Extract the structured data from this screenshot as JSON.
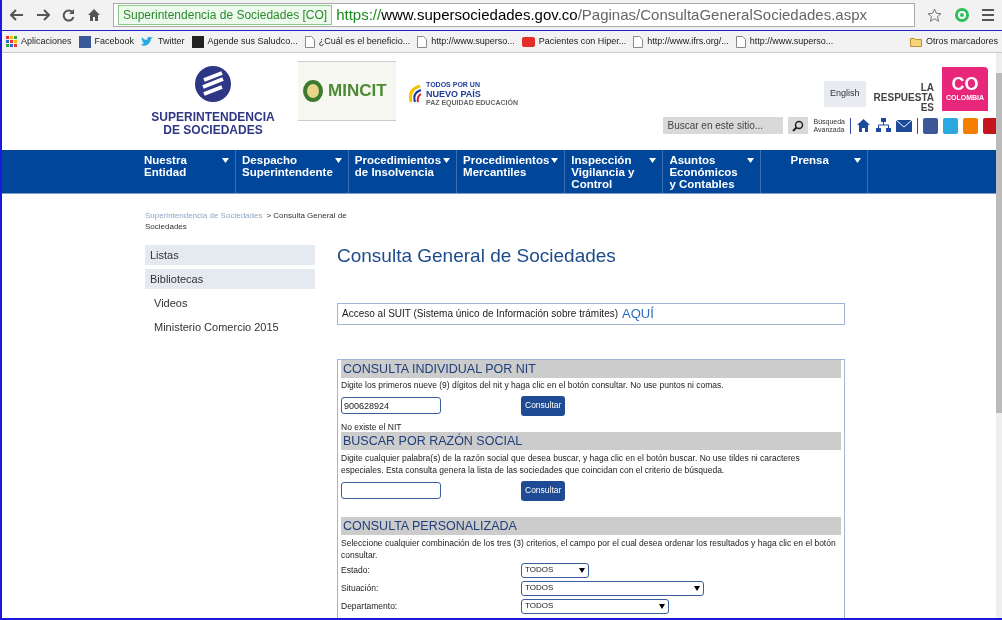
{
  "browser": {
    "site_badge": "Superintendencia de Sociedades [CO]",
    "url_scheme": "https://",
    "url_host": "www.supersociedades.gov.co",
    "url_path": "/Paginas/ConsultaGeneralSociedades.aspx"
  },
  "bookmarks": [
    {
      "kind": "apps",
      "label": "Aplicaciones"
    },
    {
      "kind": "facebook",
      "label": "Facebook"
    },
    {
      "kind": "twitter",
      "label": "Twitter"
    },
    {
      "kind": "info",
      "label": "Agende sus Saludco..."
    },
    {
      "kind": "page",
      "label": "¿Cuál es el beneficio..."
    },
    {
      "kind": "page",
      "label": "http://www.superso..."
    },
    {
      "kind": "youtube",
      "label": "Pacientes con Hiper..."
    },
    {
      "kind": "page",
      "label": "http://www.ifrs.org/..."
    },
    {
      "kind": "page",
      "label": "http://www.superso..."
    }
  ],
  "other_bookmarks": "Otros marcadores",
  "header": {
    "logo_line1": "SUPERINTENDENCIA",
    "logo_line2": "DE SOCIEDADES",
    "mincit": "MINCIT",
    "todos_line1": "TODOS POR UN",
    "todos_line2": "NUEVO PAÍS",
    "todos_line3": "PAZ  EQUIDAD  EDUCACIÓN",
    "english": "English",
    "respuesta": [
      "LA",
      "RESPUESTA",
      "ES"
    ],
    "co": "CO",
    "colombia": "COLOMBIA",
    "search_placeholder": "Buscar en este sitio...",
    "advanced_line1": "Búsqueda",
    "advanced_line2": "Avanzada"
  },
  "nav": [
    "Nuestra Entidad",
    "Despacho Superintendente",
    "Procedimientos de Insolvencia",
    "Procedimientos Mercantiles",
    "Inspección Vigilancia y Control",
    "Asuntos Económicos y Contables",
    "Prensa"
  ],
  "breadcrumb": {
    "parent": "Superintendencia de Sociedades",
    "current": "> Consulta General de Sociedades"
  },
  "sidebar": [
    {
      "label": "Listas",
      "highlighted": true
    },
    {
      "label": "Bibliotecas",
      "highlighted": true
    },
    {
      "label": "Videos",
      "highlighted": false
    },
    {
      "label": "Ministerio Comercio 2015",
      "highlighted": false
    }
  ],
  "page_title": "Consulta General de Sociedades",
  "suit": {
    "text": "Acceso al SUIT (Sistema único de Información sobre trámites)",
    "link": "AQUÍ"
  },
  "nit_section": {
    "heading": "CONSULTA INDIVIDUAL POR NIT",
    "instructions": "Digite los primeros nueve (9) dígitos del nit y haga clic en el botón consultar. No use puntos ni comas.",
    "value": "900628924",
    "button": "Consultar",
    "message": "No existe el NIT"
  },
  "razon_section": {
    "heading": "BUSCAR POR RAZÓN SOCIAL",
    "instructions": "Digite cualquier palabra(s) de la razón social que desea buscar, y haga clic en el botón buscar. No use tildes ni caracteres especiales. Esta consulta genera la lista de las sociedades que coincidan con el criterio de búsqueda.",
    "button": "Consultar"
  },
  "custom_section": {
    "heading": "CONSULTA PERSONALIZADA",
    "instructions": "Seleccione cualquier combinación de los tres (3) criterios, el campo por el cual desea ordenar los resultados y haga clic en el botón consultar.",
    "filters": [
      {
        "label": "Estado:",
        "value": "TODOS"
      },
      {
        "label": "Situación:",
        "value": "TODOS"
      },
      {
        "label": "Departamento:",
        "value": "TODOS"
      }
    ]
  }
}
